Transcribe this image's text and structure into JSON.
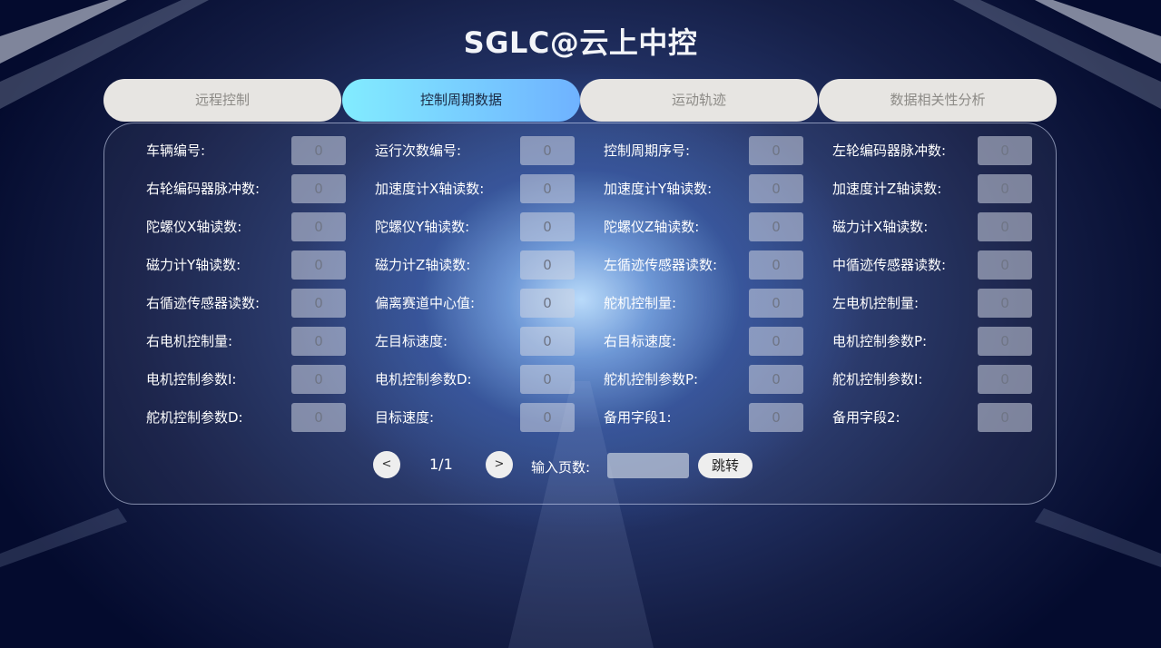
{
  "header": {
    "title": "SGLC@云上中控"
  },
  "tabs": [
    {
      "label": "远程控制"
    },
    {
      "label": "控制周期数据"
    },
    {
      "label": "运动轨迹"
    },
    {
      "label": "数据相关性分析"
    }
  ],
  "fields": [
    {
      "label": "车辆编号:",
      "value": "0"
    },
    {
      "label": "运行次数编号:",
      "value": "0"
    },
    {
      "label": "控制周期序号:",
      "value": "0"
    },
    {
      "label": "左轮编码器脉冲数:",
      "value": "0"
    },
    {
      "label": "右轮编码器脉冲数:",
      "value": "0"
    },
    {
      "label": "加速度计X轴读数:",
      "value": "0"
    },
    {
      "label": "加速度计Y轴读数:",
      "value": "0"
    },
    {
      "label": "加速度计Z轴读数:",
      "value": "0"
    },
    {
      "label": "陀螺仪X轴读数:",
      "value": "0"
    },
    {
      "label": "陀螺仪Y轴读数:",
      "value": "0"
    },
    {
      "label": "陀螺仪Z轴读数:",
      "value": "0"
    },
    {
      "label": "磁力计X轴读数:",
      "value": "0"
    },
    {
      "label": "磁力计Y轴读数:",
      "value": "0"
    },
    {
      "label": "磁力计Z轴读数:",
      "value": "0"
    },
    {
      "label": "左循迹传感器读数:",
      "value": "0"
    },
    {
      "label": "中循迹传感器读数:",
      "value": "0"
    },
    {
      "label": "右循迹传感器读数:",
      "value": "0"
    },
    {
      "label": "偏离赛道中心值:",
      "value": "0"
    },
    {
      "label": "舵机控制量:",
      "value": "0"
    },
    {
      "label": "左电机控制量:",
      "value": "0"
    },
    {
      "label": "右电机控制量:",
      "value": "0"
    },
    {
      "label": "左目标速度:",
      "value": "0"
    },
    {
      "label": "右目标速度:",
      "value": "0"
    },
    {
      "label": "电机控制参数P:",
      "value": "0"
    },
    {
      "label": "电机控制参数I:",
      "value": "0"
    },
    {
      "label": "电机控制参数D:",
      "value": "0"
    },
    {
      "label": "舵机控制参数P:",
      "value": "0"
    },
    {
      "label": "舵机控制参数I:",
      "value": "0"
    },
    {
      "label": "舵机控制参数D:",
      "value": "0"
    },
    {
      "label": "目标速度:",
      "value": "0"
    },
    {
      "label": "备用字段1:",
      "value": "0"
    },
    {
      "label": "备用字段2:",
      "value": "0"
    }
  ],
  "pagination": {
    "prev_label": "<",
    "next_label": ">",
    "page_indicator": "1/1",
    "input_label": "输入页数:",
    "input_value": "",
    "jump_label": "跳转"
  }
}
